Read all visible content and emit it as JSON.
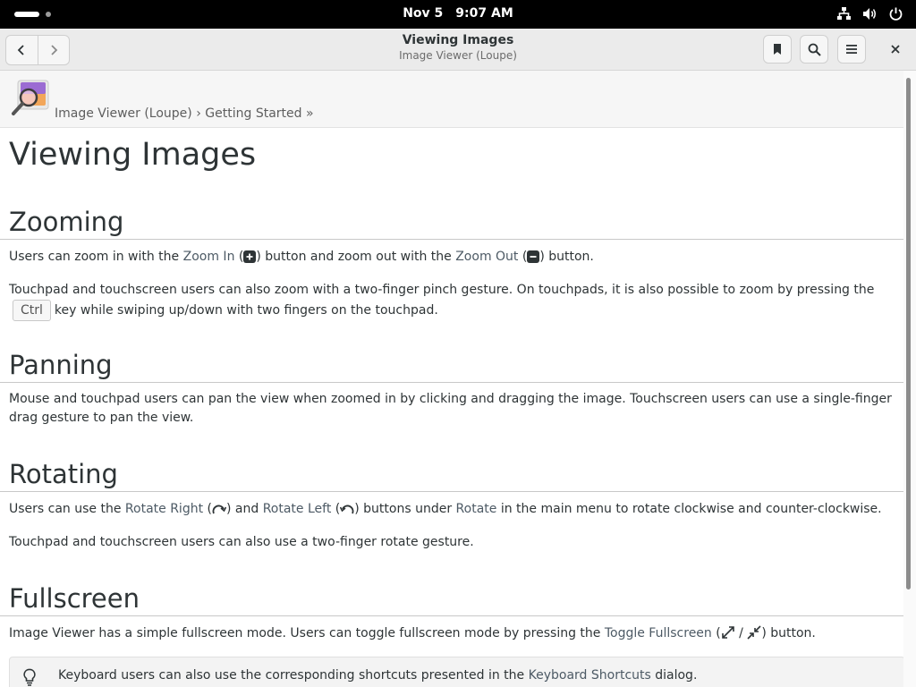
{
  "system": {
    "date": "Nov 5",
    "time": "9:07 AM"
  },
  "header": {
    "title": "Viewing Images",
    "subtitle": "Image Viewer (Loupe)"
  },
  "breadcrumb": {
    "item1": "Image Viewer (Loupe)",
    "sep": "›",
    "item2": "Getting Started »"
  },
  "page": {
    "title": "Viewing Images",
    "zooming": {
      "heading": "Zooming",
      "p1_a": "Users can zoom in with the ",
      "p1_link1": "Zoom In",
      "p1_b": " (",
      "p1_c": ") button and zoom out with the ",
      "p1_link2": "Zoom Out",
      "p1_d": " (",
      "p1_e": ") button.",
      "p2_a": "Touchpad and touchscreen users can also zoom with a two-finger pinch gesture. On touchpads, it is also possible to zoom by pressing the",
      "p2_key": "Ctrl",
      "p2_b": "key while swiping up/down with two fingers on the touchpad."
    },
    "panning": {
      "heading": "Panning",
      "p1": "Mouse and touchpad users can pan the view when zoomed in by clicking and dragging the image. Touchscreen users can use a single-finger drag gesture to pan the view."
    },
    "rotating": {
      "heading": "Rotating",
      "p1_a": "Users can use the ",
      "p1_link1": "Rotate Right",
      "p1_b": " (",
      "p1_c": ") and ",
      "p1_link2": "Rotate Left",
      "p1_d": " (",
      "p1_e": ") buttons under ",
      "p1_link3": "Rotate",
      "p1_f": " in the main menu to rotate clockwise and counter-clockwise.",
      "p2": "Touchpad and touchscreen users can also use a two-finger rotate gesture."
    },
    "fullscreen": {
      "heading": "Fullscreen",
      "p1_a": "Image Viewer has a simple fullscreen mode. Users can toggle fullscreen mode by pressing the ",
      "p1_link": "Toggle Fullscreen",
      "p1_b": " (",
      "p1_slash": " / ",
      "p1_c": ") button."
    },
    "note": {
      "a": "Keyboard users can also use the corresponding shortcuts presented in the ",
      "link": "Keyboard Shortcuts",
      "b": " dialog."
    }
  },
  "icons": {
    "back": "go-previous-icon",
    "forward": "go-next-icon",
    "bookmark": "bookmark-icon",
    "search": "search-icon",
    "menu": "hamburger-menu-icon",
    "close": "close-icon",
    "network": "network-icon",
    "volume": "volume-icon",
    "power": "power-icon",
    "tip": "lightbulb-icon"
  },
  "colors": {
    "link": "#4d5a65",
    "headerbar": "#ebebeb"
  }
}
